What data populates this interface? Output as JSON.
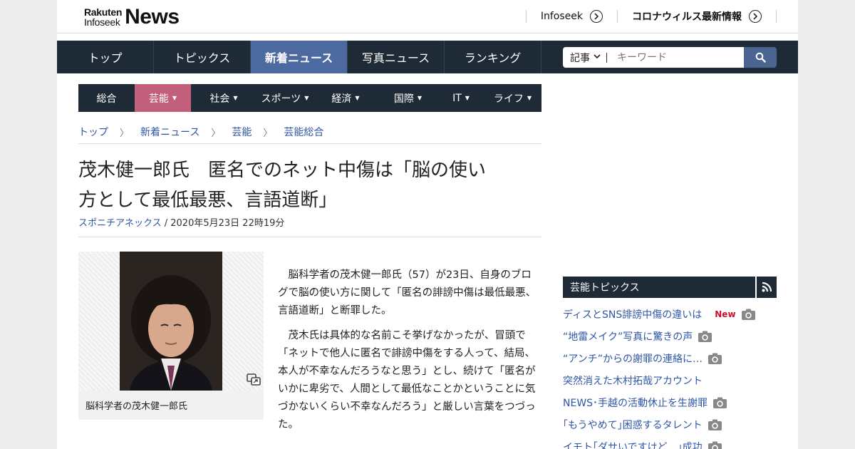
{
  "header": {
    "logo_small_1": "Rakuten",
    "logo_small_2": "Infoseek",
    "logo_big": "News",
    "links": [
      {
        "label": "Infoseek"
      },
      {
        "label": "コロナウィルス最新情報"
      }
    ]
  },
  "main_nav": {
    "items": [
      {
        "label": "トップ"
      },
      {
        "label": "トピックス"
      },
      {
        "label": "新着ニュース",
        "active": true
      },
      {
        "label": "写真ニュース"
      },
      {
        "label": "ランキング"
      }
    ]
  },
  "search": {
    "select_value": "記事",
    "placeholder": "キーワード"
  },
  "sub_nav": {
    "items": [
      {
        "label": "総合"
      },
      {
        "label": "芸能",
        "active": true
      },
      {
        "label": "社会"
      },
      {
        "label": "スポーツ"
      },
      {
        "label": "経済"
      },
      {
        "label": "国際"
      },
      {
        "label": "IT"
      },
      {
        "label": "ライフ"
      }
    ]
  },
  "breadcrumb": [
    "トップ",
    "新着ニュース",
    "芸能",
    "芸能総合"
  ],
  "article": {
    "title_line1": "茂木健一郎氏　匿名でのネット中傷は「脳の使い",
    "title_line2": "方として最低最悪、言語道断」",
    "source": "スポニチアネックス",
    "date": " / 2020年5月23日 22時19分",
    "photo_caption": "脳科学者の茂木健一郎氏",
    "paragraphs": [
      "脳科学者の茂木健一郎氏（57）が23日、自身のブログで脳の使い方に関して「匿名の誹謗中傷は最低最悪、言語道断」と断罪した。",
      "茂木氏は具体的な名前こそ挙げなかったが、冒頭で「ネットで他人に匿名で誹謗中傷をする人って、結局、本人が不幸なんだろうなと思う」とし、続けて「匿名がいかに卑劣で、人間として最低なことかということに気づかないくらい不幸なんだろう」と厳しい言葉をつづった。"
    ]
  },
  "sidebar": {
    "topics_title": "芸能トピックス",
    "new_label": "New",
    "topics": [
      {
        "label": "ディスとSNS誹謗中傷の違いは",
        "new": true,
        "camera": true
      },
      {
        "label": "“地雷メイク”写真に驚きの声",
        "new": false,
        "camera": true
      },
      {
        "label": "“アンチ”からの謝罪の連絡に…",
        "new": false,
        "camera": true
      },
      {
        "label": "突然消えた木村拓哉アカウント",
        "new": false,
        "camera": false
      },
      {
        "label": "NEWS･手越の活動休止を生謝罪",
        "new": false,
        "camera": true
      },
      {
        "label": "｢もうやめて｣困惑するタレント",
        "new": false,
        "camera": true
      },
      {
        "label": "イモト｢ダサいですけど…｣成功",
        "new": false,
        "camera": true
      }
    ]
  },
  "colors": {
    "nav_bg": "#1f2a37",
    "nav_active": "#4c6a9f",
    "subnav_active": "#c25f7d",
    "link": "#2f56a5",
    "new_badge": "#c8102e"
  }
}
